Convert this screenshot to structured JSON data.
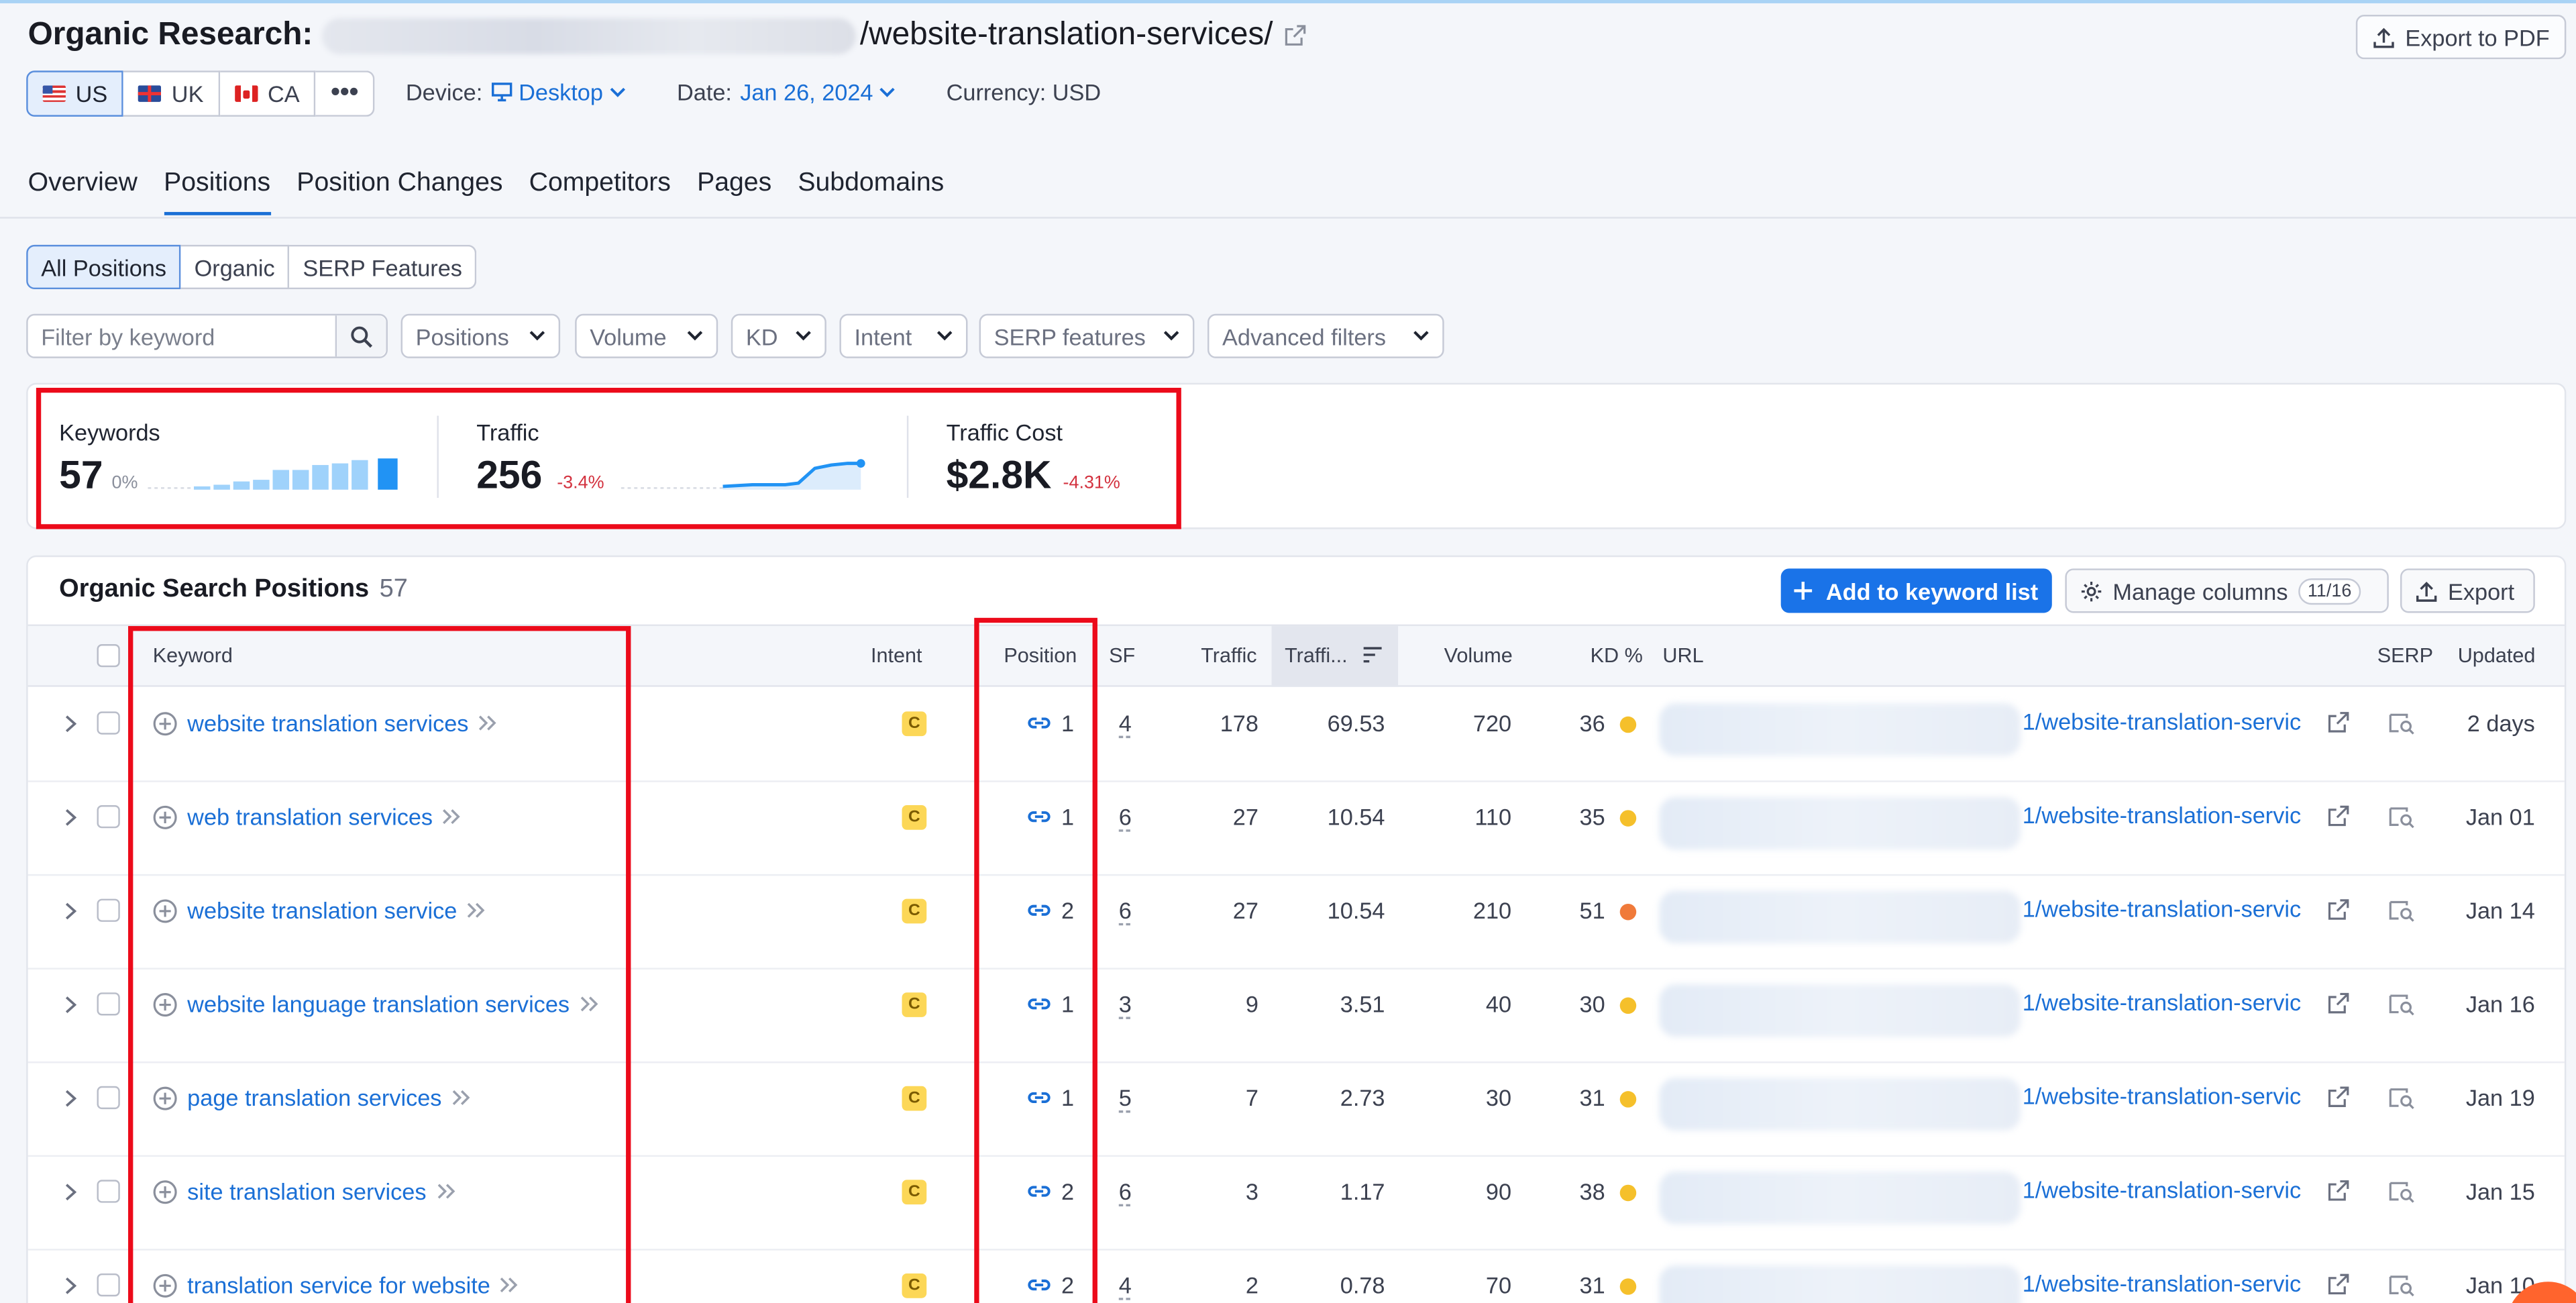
{
  "header": {
    "title_prefix": "Organic Research:",
    "title_path": "/website-translation-services/",
    "export_pdf": "Export to PDF"
  },
  "databases": [
    {
      "code": "US",
      "active": true
    },
    {
      "code": "UK",
      "active": false
    },
    {
      "code": "CA",
      "active": false
    }
  ],
  "more_label": "•••",
  "meta": {
    "device_label": "Device:",
    "device_value": "Desktop",
    "date_label": "Date:",
    "date_value": "Jan 26, 2024",
    "currency": "Currency: USD"
  },
  "tabs": [
    "Overview",
    "Positions",
    "Position Changes",
    "Competitors",
    "Pages",
    "Subdomains"
  ],
  "segments": [
    "All Positions",
    "Organic",
    "SERP Features"
  ],
  "filters": {
    "placeholder": "Filter by keyword",
    "dropdowns": [
      "Positions",
      "Volume",
      "KD",
      "Intent",
      "SERP features",
      "Advanced filters"
    ]
  },
  "summary": {
    "keywords": {
      "label": "Keywords",
      "value": "57",
      "delta": "0%"
    },
    "traffic": {
      "label": "Traffic",
      "value": "256",
      "delta": "-3.4%"
    },
    "traffic_cost": {
      "label": "Traffic Cost",
      "value": "$2.8K",
      "delta": "-4.31%"
    }
  },
  "table": {
    "title": "Organic Search Positions",
    "count": "57",
    "add_button": "Add to keyword list",
    "manage_columns": "Manage columns",
    "manage_badge": "11/16",
    "export": "Export",
    "columns": {
      "keyword": "Keyword",
      "intent": "Intent",
      "position": "Position",
      "sf": "SF",
      "traffic": "Traffic",
      "traffic_pct": "Traffi...",
      "volume": "Volume",
      "kd": "KD %",
      "url": "URL",
      "serp": "SERP",
      "updated": "Updated"
    },
    "rows": [
      {
        "keyword": "website translation services",
        "intent": "C",
        "position": "1",
        "sf": "4",
        "traffic": "178",
        "traffic_pct": "69.53",
        "volume": "720",
        "kd": "36",
        "kd_color": "#f5c02b",
        "url": "1/website-translation-servic",
        "updated": "2 days"
      },
      {
        "keyword": "web translation services",
        "intent": "C",
        "position": "1",
        "sf": "6",
        "traffic": "27",
        "traffic_pct": "10.54",
        "volume": "110",
        "kd": "35",
        "kd_color": "#f5c02b",
        "url": "1/website-translation-servic",
        "updated": "Jan 01"
      },
      {
        "keyword": "website translation service",
        "intent": "C",
        "position": "2",
        "sf": "6",
        "traffic": "27",
        "traffic_pct": "10.54",
        "volume": "210",
        "kd": "51",
        "kd_color": "#f07a3a",
        "url": "1/website-translation-servic",
        "updated": "Jan 14"
      },
      {
        "keyword": "website language translation services",
        "intent": "C",
        "position": "1",
        "sf": "3",
        "traffic": "9",
        "traffic_pct": "3.51",
        "volume": "40",
        "kd": "30",
        "kd_color": "#f5c02b",
        "url": "1/website-translation-servic",
        "updated": "Jan 16"
      },
      {
        "keyword": "page translation services",
        "intent": "C",
        "position": "1",
        "sf": "5",
        "traffic": "7",
        "traffic_pct": "2.73",
        "volume": "30",
        "kd": "31",
        "kd_color": "#f5c02b",
        "url": "1/website-translation-servic",
        "updated": "Jan 19"
      },
      {
        "keyword": "site translation services",
        "intent": "C",
        "position": "2",
        "sf": "6",
        "traffic": "3",
        "traffic_pct": "1.17",
        "volume": "90",
        "kd": "38",
        "kd_color": "#f5c02b",
        "url": "1/website-translation-servic",
        "updated": "Jan 15"
      },
      {
        "keyword": "translation service for website",
        "intent": "C",
        "position": "2",
        "sf": "4",
        "traffic": "2",
        "traffic_pct": "0.78",
        "volume": "70",
        "kd": "31",
        "kd_color": "#f5c02b",
        "url": "1/website-translation-servic",
        "updated": "Jan 10"
      }
    ]
  },
  "colors": {
    "accent": "#1a73e8",
    "link": "#1a6fd6",
    "highlight_box": "#ec0a1a",
    "negative": "#d3323f",
    "intent_commercial": "#fcd757"
  },
  "icons": {
    "external_link": "external-link-icon",
    "export": "upload-icon",
    "search": "search-icon",
    "gear": "gear-icon",
    "chevron": "chevron-down-icon",
    "link": "link-icon",
    "serp": "serp-snapshot-icon",
    "add": "plus-icon"
  }
}
